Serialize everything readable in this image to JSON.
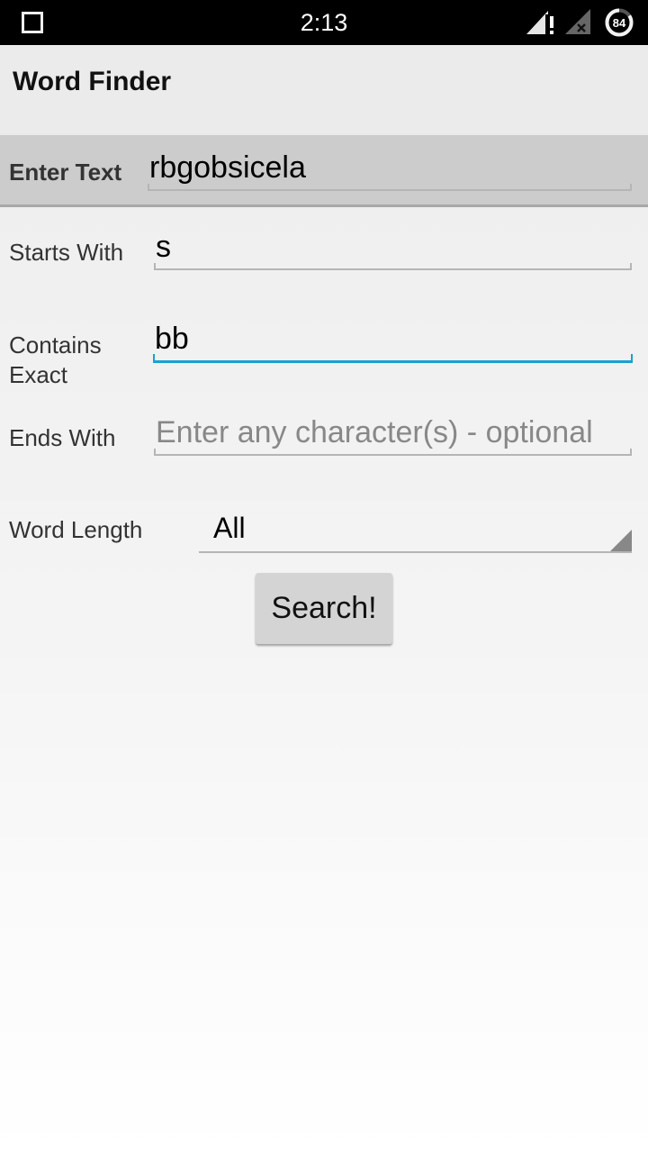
{
  "status_bar": {
    "time": "2:13",
    "battery_level": "84",
    "icons": [
      "recent-apps-square-icon",
      "signal-warning-icon",
      "no-sim-icon",
      "battery-circle-icon"
    ]
  },
  "app": {
    "title": "Word Finder"
  },
  "form": {
    "enter_text": {
      "label": "Enter Text",
      "value": "rbgobsicela"
    },
    "starts_with": {
      "label": "Starts With",
      "value": "s"
    },
    "contains_exact": {
      "label_line1": "Contains",
      "label_line2": "Exact",
      "value": "bb",
      "focused": true
    },
    "ends_with": {
      "label": "Ends With",
      "value": "",
      "placeholder": "Enter any character(s) - optional"
    },
    "word_length": {
      "label": "Word Length",
      "selected": "All"
    },
    "search_button_label": "Search!"
  },
  "colors": {
    "focus_accent": "#1ba1cf",
    "enter_band": "#cccccc",
    "status_bar": "#000000"
  }
}
